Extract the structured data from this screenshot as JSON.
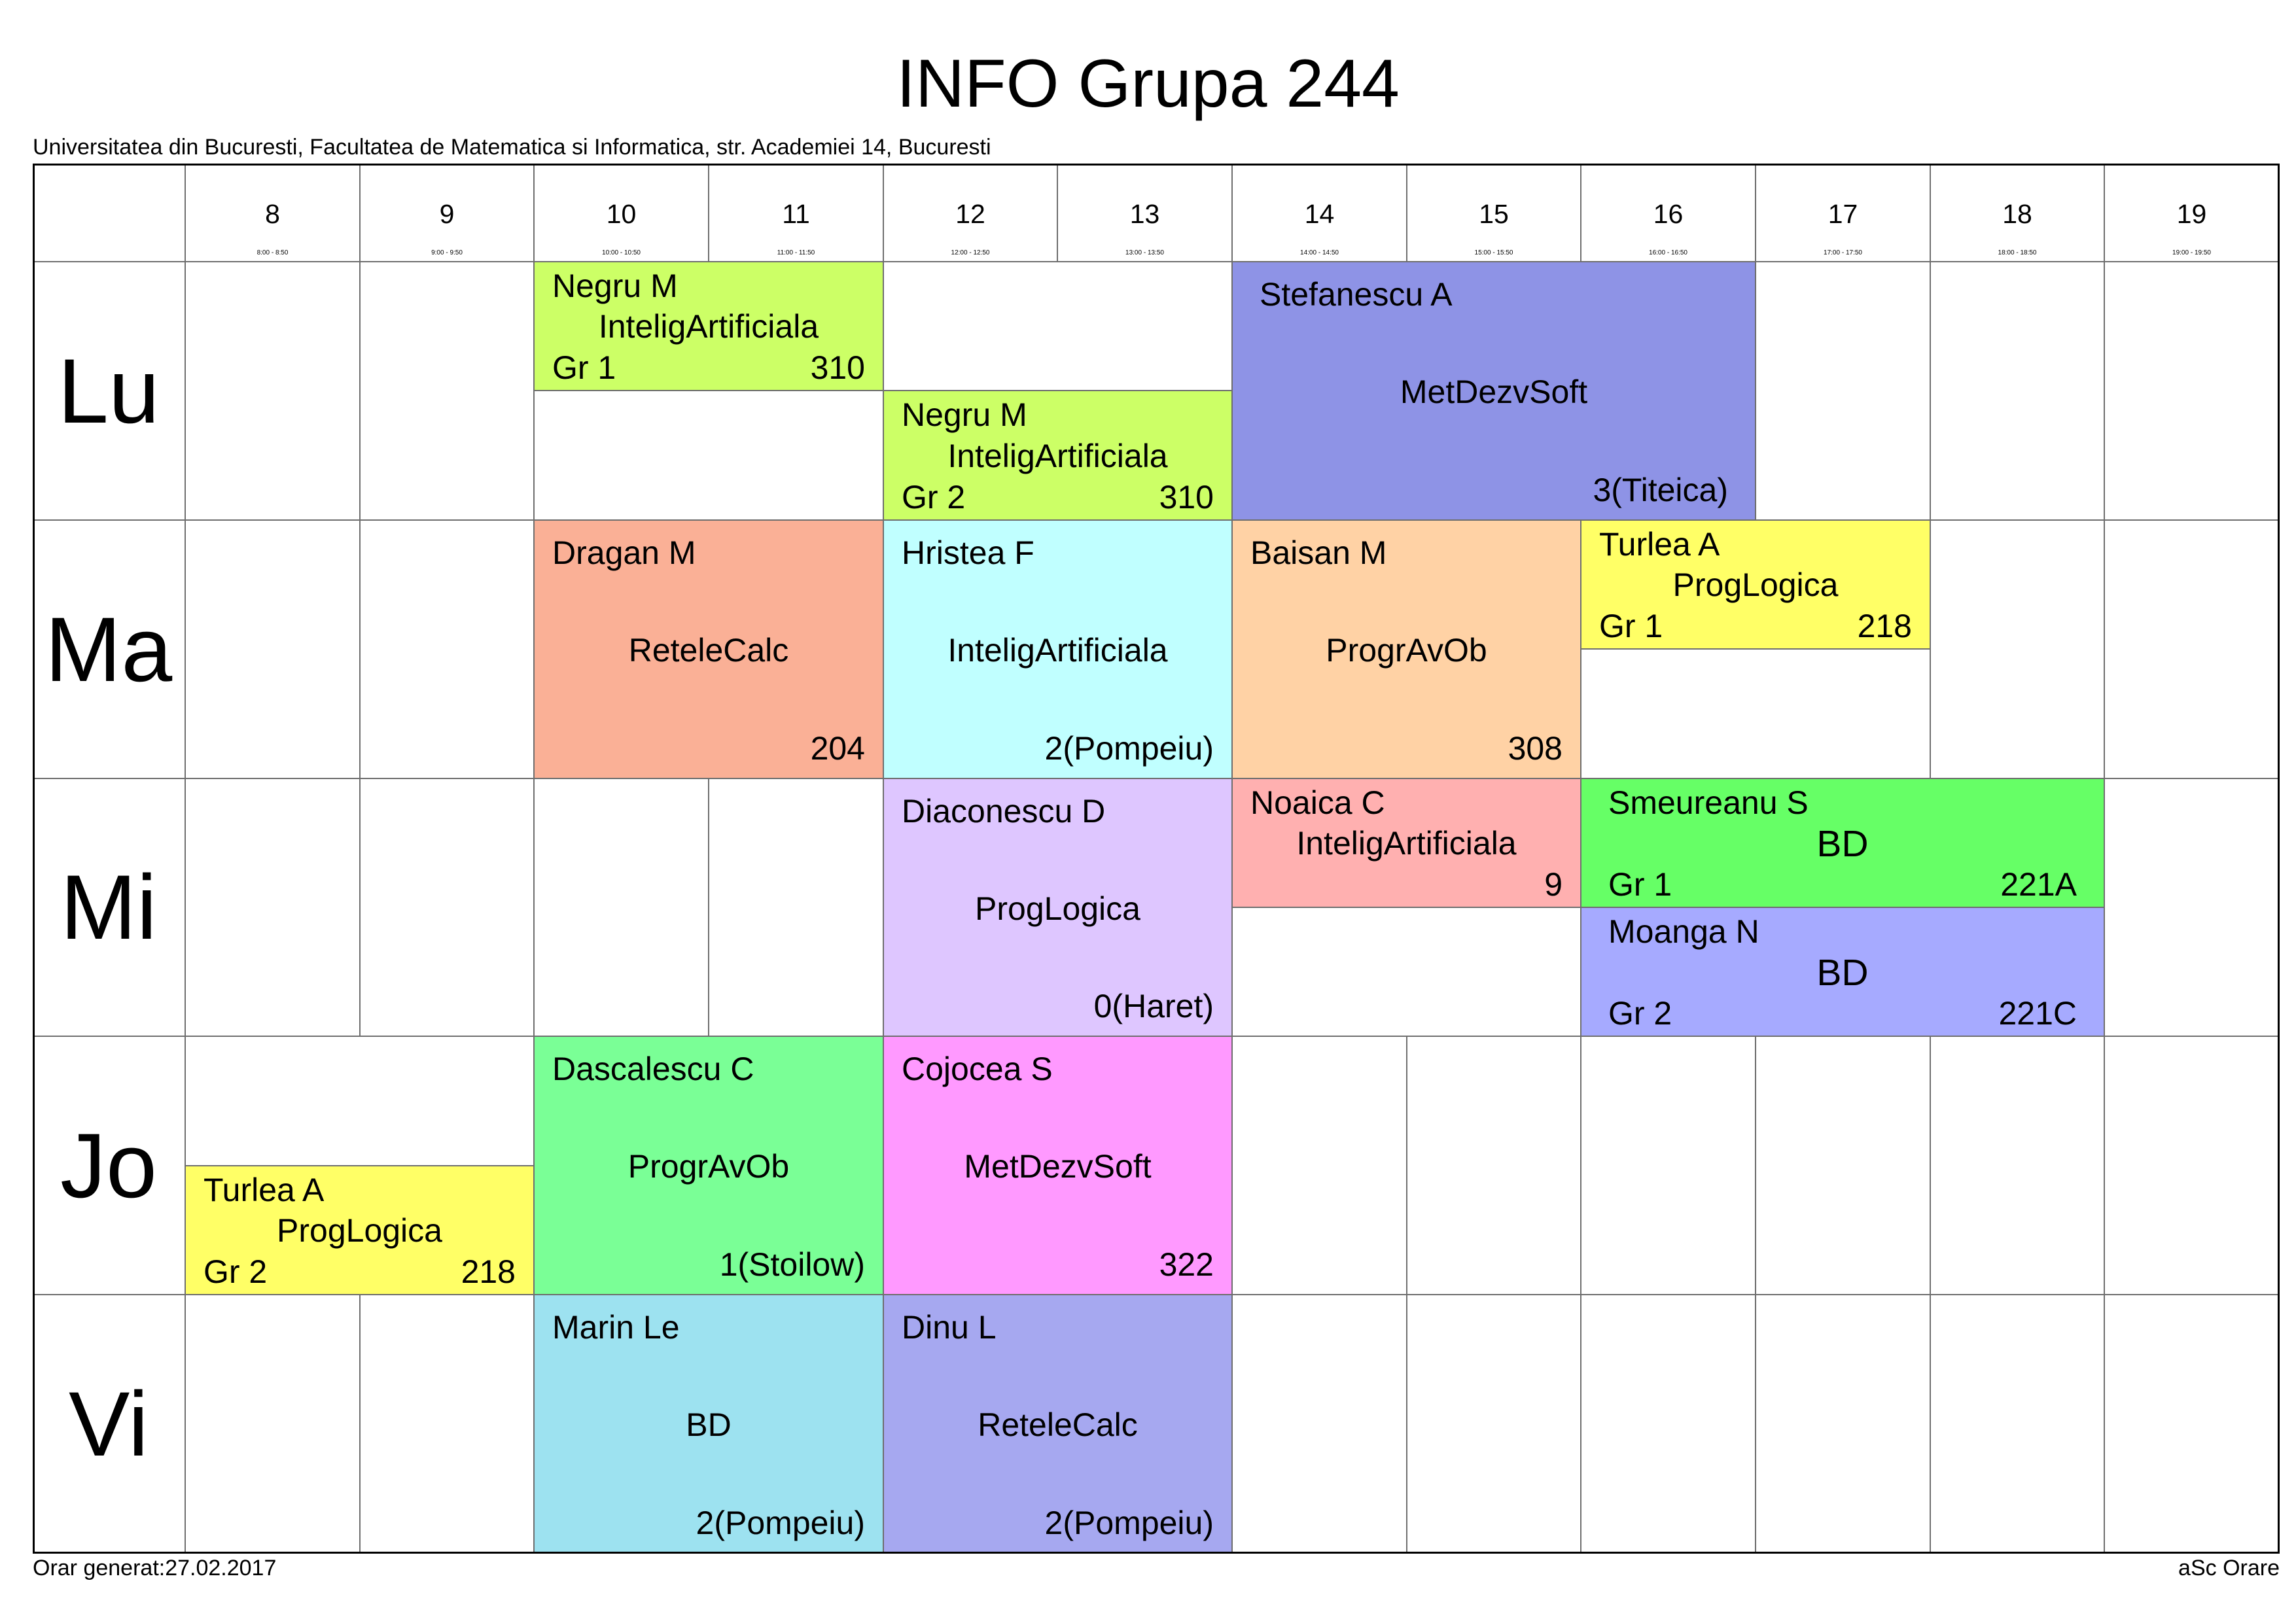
{
  "title": "INFO Grupa 244",
  "subtitle": "Universitatea din Bucuresti, Facultatea de Matematica si Informatica, str. Academiei 14, Bucuresti",
  "footer": {
    "generated": "Orar generat:27.02.2017",
    "software": "aSc Orare"
  },
  "hours": [
    {
      "label": "8",
      "time": "8:00 - 8:50"
    },
    {
      "label": "9",
      "time": "9:00 - 9:50"
    },
    {
      "label": "10",
      "time": "10:00 - 10:50"
    },
    {
      "label": "11",
      "time": "11:00 - 11:50"
    },
    {
      "label": "12",
      "time": "12:00 - 12:50"
    },
    {
      "label": "13",
      "time": "13:00 - 13:50"
    },
    {
      "label": "14",
      "time": "14:00 - 14:50"
    },
    {
      "label": "15",
      "time": "15:00 - 15:50"
    },
    {
      "label": "16",
      "time": "16:00 - 16:50"
    },
    {
      "label": "17",
      "time": "17:00 - 17:50"
    },
    {
      "label": "18",
      "time": "18:00 - 18:50"
    },
    {
      "label": "19",
      "time": "19:00 - 19:50"
    }
  ],
  "days": [
    {
      "label": "Lu",
      "events": [
        {
          "teacher": "Negru M",
          "subject": "InteligArtificiala",
          "group": "Gr 1",
          "room": "310",
          "start": 10,
          "duration": 2,
          "half": 1,
          "color": "#CCFF66"
        },
        {
          "teacher": "Negru M",
          "subject": "InteligArtificiala",
          "group": "Gr 2",
          "room": "310",
          "start": 12,
          "duration": 2,
          "half": 2,
          "color": "#CCFF66"
        },
        {
          "teacher": "Stefanescu A",
          "subject": "MetDezvSoft",
          "room": "3(Titeica)",
          "start": 14,
          "duration": 3,
          "color": "#8E93E6"
        }
      ]
    },
    {
      "label": "Ma",
      "events": [
        {
          "teacher": "Dragan M",
          "subject": "ReteleCalc",
          "room": "204",
          "start": 10,
          "duration": 2,
          "color": "#FAB096"
        },
        {
          "teacher": "Hristea F",
          "subject": "InteligArtificiala",
          "room": "2(Pompeiu)",
          "start": 12,
          "duration": 2,
          "color": "#C0FFFF"
        },
        {
          "teacher": "Baisan M",
          "subject": "ProgrAvOb",
          "room": "308",
          "start": 14,
          "duration": 2,
          "color": "#FFD2A5"
        },
        {
          "teacher": "Turlea A",
          "subject": "ProgLogica",
          "group": "Gr 1",
          "room": "218",
          "start": 16,
          "duration": 2,
          "half": 1,
          "color": "#FFFF66"
        }
      ]
    },
    {
      "label": "Mi",
      "events": [
        {
          "teacher": "Diaconescu D",
          "subject": "ProgLogica",
          "room": "0(Haret)",
          "start": 12,
          "duration": 2,
          "color": "#DEC6FF"
        },
        {
          "teacher": "Noaica C",
          "subject": "InteligArtificiala",
          "room": "9",
          "start": 14,
          "duration": 2,
          "half": 1,
          "color": "#FFB0B0"
        },
        {
          "teacher": "Smeureanu S",
          "subject": "BD",
          "group": "Gr 1",
          "room": "221A",
          "start": 16,
          "duration": 3,
          "half": 1,
          "color": "#66FF66"
        },
        {
          "teacher": "Moanga N",
          "subject": "BD",
          "group": "Gr 2",
          "room": "221C",
          "start": 16,
          "duration": 3,
          "half": 2,
          "color": "#A6AAFF"
        }
      ]
    },
    {
      "label": "Jo",
      "events": [
        {
          "teacher": "Turlea A",
          "subject": "ProgLogica",
          "group": "Gr 2",
          "room": "218",
          "start": 8,
          "duration": 2,
          "half": 2,
          "color": "#FFFF66"
        },
        {
          "teacher": "Dascalescu C",
          "subject": "ProgrAvOb",
          "room": "1(Stoilow)",
          "start": 10,
          "duration": 2,
          "color": "#7AFF96"
        },
        {
          "teacher": "Cojocea S",
          "subject": "MetDezvSoft",
          "room": "322",
          "start": 12,
          "duration": 2,
          "color": "#FF99FF"
        }
      ]
    },
    {
      "label": "Vi",
      "events": [
        {
          "teacher": "Marin Le",
          "subject": "BD",
          "room": "2(Pompeiu)",
          "start": 10,
          "duration": 2,
          "color": "#9DE2F0"
        },
        {
          "teacher": "Dinu L",
          "subject": "ReteleCalc",
          "room": "2(Pompeiu)",
          "start": 12,
          "duration": 2,
          "color": "#A6A8F0"
        }
      ]
    }
  ]
}
